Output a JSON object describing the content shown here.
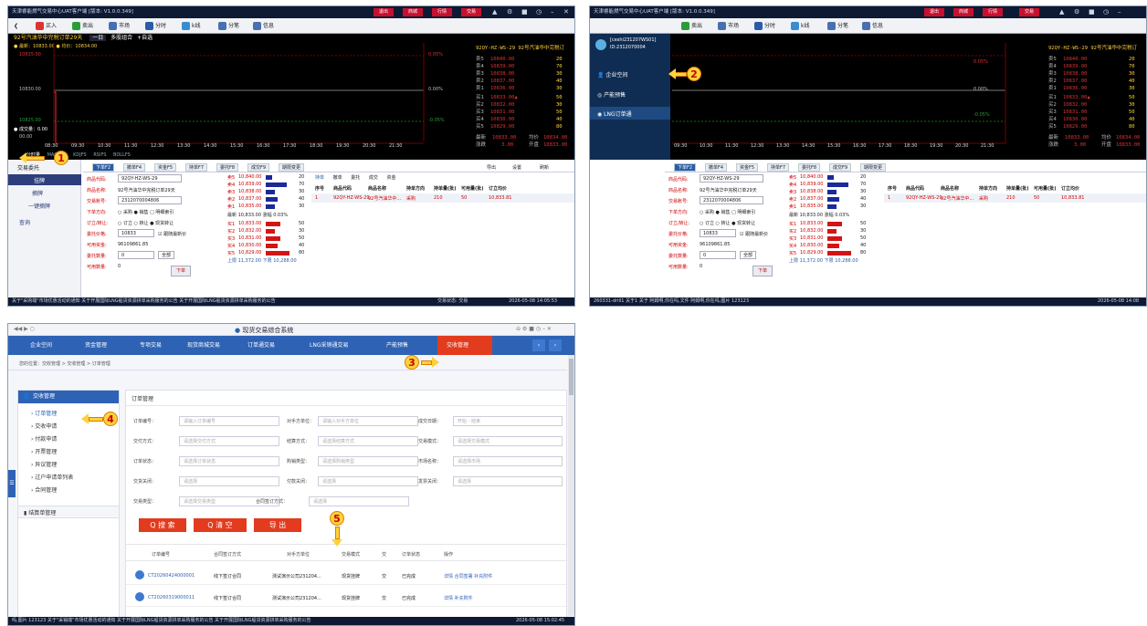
{
  "panel1": {
    "title": "天津睿能燃气交易中心UAT客户端 [版本: V1.0.0.349]",
    "title_buttons": [
      "退出",
      "商城",
      "行情",
      "交易"
    ],
    "toolbar": [
      "买入",
      "卖出",
      "市场",
      "分时",
      "k线",
      "分笔",
      "信息"
    ],
    "contract_bar": "92号汽油华中完税订单29天",
    "period_buttons": [
      "一日",
      "多股组合",
      "+自选"
    ],
    "right_code": "92QY-HZ-WS-29 92号汽油华中完税订",
    "price_info": "● 最新：10833.00 ● 均价：10834.00",
    "price_levels": [
      "10835.00",
      "10830.00",
      "10825.00"
    ],
    "pct_levels": [
      "0.05%",
      "0.00%",
      "-0.05%"
    ],
    "vol_info": "● 成交量：0.00",
    "vol_val": "00.00",
    "times": [
      "08:30",
      "09:30",
      "10:30",
      "11:30",
      "12:30",
      "13:30",
      "14:30",
      "15:30",
      "16:30",
      "17:30",
      "18:30",
      "19:30",
      "20:30",
      "21:30"
    ],
    "indicator_tabs": [
      "分时量",
      "MACDFS",
      "KDJFS",
      "RSIFS",
      "BOLLFS"
    ],
    "quote": {
      "sell_labels": [
        "卖5",
        "卖4",
        "卖3",
        "卖2",
        "卖1"
      ],
      "sell_prices": [
        "10840.00",
        "10839.00",
        "10838.00",
        "10837.00",
        "10836.00"
      ],
      "sell_vols": [
        "20",
        "70",
        "30",
        "40",
        "30"
      ],
      "buy_labels": [
        "买1",
        "买2",
        "买3",
        "买4",
        "买5"
      ],
      "buy_prices": [
        "10833.00▲",
        "10832.00",
        "10831.00",
        "10830.00",
        "10829.00"
      ],
      "buy_vols": [
        "50",
        "30",
        "50",
        "40",
        "80"
      ],
      "latest_label": "最新",
      "latest": "10833.00",
      "avg_label": "均价",
      "avg": "10834.00",
      "change_label": "涨跌",
      "change": "3.00",
      "open_label": "开盘",
      "open": "10833.00"
    },
    "bottom_tabs": [
      "下单F2",
      "撤单F4",
      "资金F5",
      "持单F7",
      "委托F8",
      "成交F9",
      "期限变更"
    ],
    "bottom_right": [
      "导出",
      "设置",
      "刷新"
    ],
    "side_menu": {
      "delegate": "交易委托",
      "buy": "挂牌",
      "cancel": "摘牌",
      "oneclick": "一键摘牌",
      "query": "查询"
    },
    "form": {
      "code_label": "商品代码:",
      "code": "92QY-HZ-WS-29",
      "name_label": "商品名称:",
      "name": "92号汽油华中完税订单29天",
      "account_label": "交易账号:",
      "account": "2312070004806",
      "direction_label": "下单方向:",
      "direction_opts": [
        "采购",
        "销售",
        "明细索引"
      ],
      "order_label": "订立/转让:",
      "order_opts": [
        "订立",
        "转让",
        "现货转让"
      ],
      "price_label": "委托价格:",
      "price": "10833",
      "latest_chk": "跟随最新价",
      "funds_label": "可用资金:",
      "funds": "96109861.85",
      "qty_label": "委托数量:",
      "qty": "0",
      "all_btn": "全部",
      "avail_label": "可用数量:",
      "avail": "0",
      "submit": "下单"
    },
    "book": {
      "sell": [
        [
          "卖5",
          "10,840.00",
          "20"
        ],
        [
          "卖4",
          "10,839.00",
          "70"
        ],
        [
          "卖3",
          "10,838.00",
          "30"
        ],
        [
          "卖2",
          "10,837.00",
          "40"
        ],
        [
          "卖1",
          "10,835.00",
          "30"
        ]
      ],
      "latest_row": "最新 10,833.00 涨幅 0.03%",
      "buy": [
        [
          "买1",
          "10,833.00",
          "50"
        ],
        [
          "买2",
          "10,832.00",
          "30"
        ],
        [
          "买3",
          "10,831.00",
          "50"
        ],
        [
          "买4",
          "10,830.00",
          "40"
        ],
        [
          "买5",
          "10,829.00",
          "80"
        ]
      ],
      "limit_row": "上限 11,372.00 下限 10,288.00"
    },
    "hold_tabs": [
      "持单",
      "撤单",
      "委托",
      "成交",
      "资金"
    ],
    "table_headers": [
      "序号",
      "商品代码",
      "商品名称",
      "持单方向",
      "持单量(批)",
      "可用量(批)",
      "订立均价"
    ],
    "table_row": [
      "1",
      "92QY-HZ-WS-29",
      "92号汽油华中...",
      "采购",
      "210",
      "50",
      "10,833.81"
    ],
    "status": "关于\"采购端\"市场优惠活动的通知   关于开展国际LNG船货资源拼单采购服务的公告   关于开展国际LNG船货资源拼单采购服务的公告",
    "status_right": "交易状态:  交易",
    "status_time": "2026-05-08 14:05:53"
  },
  "panel2": {
    "user": "[ceshi231207WS01]",
    "user_id": "ID:2312070004",
    "menu": [
      "企业空间",
      "产能预售",
      "LNG订单通"
    ],
    "status_left": "260331-drill1  关于1  关于  阿姆啊,你在吗,文件  阿姆啊,你在吗,图片  123123",
    "status_time": "2026-05-08 14:08"
  },
  "panel3": {
    "title": "现货交易综合系统",
    "nav": [
      "企业空间",
      "资金管理",
      "专项交易",
      "现货商城交易",
      "订单通交易",
      "LNG采销通交易",
      "产能预售",
      "交收管理"
    ],
    "breadcrumb": "您的位置：交收管理 > 交收管理 > 订单管理",
    "left_header": "交收管理",
    "left_items": [
      "订单管理",
      "交收申请",
      "付款申请",
      "开票管理",
      "异议管理",
      "过户申请单列表",
      "合同管理"
    ],
    "left_header2": "结算单管理",
    "content_title": "订单管理",
    "fields": [
      {
        "label": "订单编号：",
        "ph": "请输入订单编号"
      },
      {
        "label": "对手方单位：",
        "ph": "请输入对手方单位"
      },
      {
        "label": "成交日期：",
        "ph": "开始   -   结束"
      },
      {
        "label": "交付方式：",
        "ph": "请选择交付方式"
      },
      {
        "label": "结算方式：",
        "ph": "请选择结算方式"
      },
      {
        "label": "交易模式：",
        "ph": "请选择交易模式"
      },
      {
        "label": "订单状态：",
        "ph": "请选择订单状态"
      },
      {
        "label": "购销类型：",
        "ph": "请选择购销类型"
      },
      {
        "label": "市场名称：",
        "ph": "请选择市场"
      },
      {
        "label": "交货关闭：",
        "ph": "请选择"
      },
      {
        "label": "付款关闭：",
        "ph": "请选择"
      },
      {
        "label": "发票关闭：",
        "ph": "请选择"
      },
      {
        "label": "交易类型：",
        "ph": "请选择交易类型"
      },
      {
        "label": "合同签订方式：",
        "ph": "请选择"
      }
    ],
    "buttons": [
      "Q 搜 索",
      "Q 清 空",
      "导 出"
    ],
    "table_headers": [
      "订单编号",
      "合同签订方式",
      "对手方单位",
      "交易模式",
      "交",
      "订单状态",
      "操作"
    ],
    "rows": [
      {
        "id": "CT20260424000001",
        "sign": "线下签订合同",
        "party": "测试演示公司231204...",
        "mode": "现货挂牌",
        "pay": "交",
        "status": "已完成",
        "ops": "详情  合同签署  补充附件"
      },
      {
        "id": "CT20260319000011",
        "sign": "线下签订合同",
        "party": "测试演示公司231204...",
        "mode": "现货挂牌",
        "pay": "交",
        "status": "已完成",
        "ops": "详情  补充附件"
      }
    ],
    "status": "吗,图片  123123  关于\"采销端\"市场优惠活动的通知  关于开展国际LNG船货资源拼单采购服务的公告  关于开展国际LNG船货资源拼单采购服务的公告",
    "status_time": "2026-05-08 15:02:45"
  },
  "annotations": [
    "1",
    "2",
    "3",
    "4",
    "5"
  ]
}
